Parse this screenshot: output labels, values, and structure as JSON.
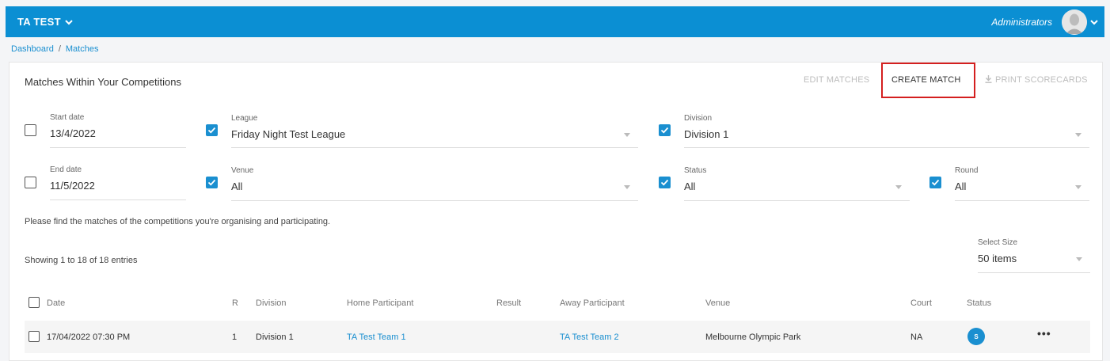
{
  "topbar": {
    "org_name": "TA TEST",
    "role": "Administrators"
  },
  "breadcrumb": {
    "dashboard": "Dashboard",
    "separator": "/",
    "matches": "Matches"
  },
  "card": {
    "title": "Matches Within Your Competitions"
  },
  "actions": {
    "edit_matches": "EDIT MATCHES",
    "create_match": "CREATE MATCH",
    "print_scorecards": "PRINT SCORECARDS"
  },
  "filters": {
    "start_date": {
      "label": "Start date",
      "value": "13/4/2022",
      "checked": false
    },
    "end_date": {
      "label": "End date",
      "value": "11/5/2022",
      "checked": false
    },
    "league": {
      "label": "League",
      "value": "Friday Night Test League",
      "checked": true
    },
    "venue": {
      "label": "Venue",
      "value": "All",
      "checked": true
    },
    "division": {
      "label": "Division",
      "value": "Division 1",
      "checked": true
    },
    "status": {
      "label": "Status",
      "value": "All",
      "checked": true
    },
    "round": {
      "label": "Round",
      "value": "All",
      "checked": true
    }
  },
  "info_text": "Please find the matches of the competitions you're organising and participating.",
  "showing_text": "Showing 1 to 18 of 18 entries",
  "select_size": {
    "label": "Select Size",
    "value": "50 items"
  },
  "table": {
    "headers": {
      "date": "Date",
      "round": "R",
      "division": "Division",
      "home": "Home Participant",
      "result": "Result",
      "away": "Away Participant",
      "venue": "Venue",
      "court": "Court",
      "status": "Status"
    },
    "rows": [
      {
        "date": "17/04/2022 07:30 PM",
        "round": "1",
        "division": "Division 1",
        "home": "TA Test Team 1",
        "result": "",
        "away": "TA Test Team 2",
        "venue": "Melbourne Olympic Park",
        "court": "NA",
        "status": "S",
        "more": "•••"
      }
    ]
  },
  "colors": {
    "brand": "#0b8fd3",
    "link": "#1a8fd0",
    "highlight": "#d41f1f"
  }
}
